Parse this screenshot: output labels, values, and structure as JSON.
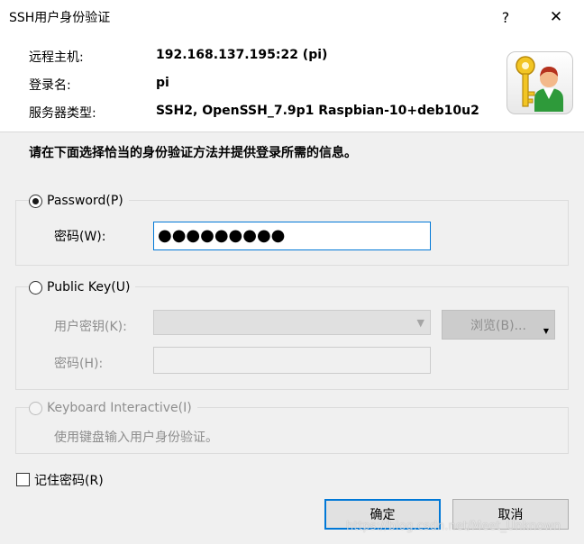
{
  "window": {
    "title": "SSH用户身份验证",
    "help_glyph": "?",
    "close_glyph": "✕"
  },
  "info": {
    "host_label": "远程主机:",
    "host_value": "192.168.137.195:22 (pi)",
    "login_label": "登录名:",
    "login_value": "pi",
    "server_type_label": "服务器类型:",
    "server_type_value": "SSH2, OpenSSH_7.9p1 Raspbian-10+deb10u2",
    "icon": "key-user-icon"
  },
  "instruction": "请在下面选择恰当的身份验证方法并提供登录所需的信息。",
  "password_method": {
    "label": "Password(P)",
    "selected": true,
    "password_label": "密码(W):",
    "password_mask": "●●●●●●●●●"
  },
  "public_key_method": {
    "label": "Public Key(U)",
    "selected": false,
    "user_key_label": "用户密钥(K):",
    "user_key_value": "",
    "browse_label": "浏览(B)...",
    "passphrase_label": "密码(H):"
  },
  "keyboard_method": {
    "label": "Keyboard Interactive(I)",
    "description": "使用键盘输入用户身份验证。",
    "enabled": false
  },
  "remember_password": {
    "label": "记住密码(R)",
    "checked": false
  },
  "buttons": {
    "ok": "确定",
    "cancel": "取消"
  },
  "watermark": "https://blog.csdn.net/Meet_Unknown",
  "colors": {
    "focus_blue": "#0078d7",
    "panel_gray": "#f0f0f0"
  }
}
